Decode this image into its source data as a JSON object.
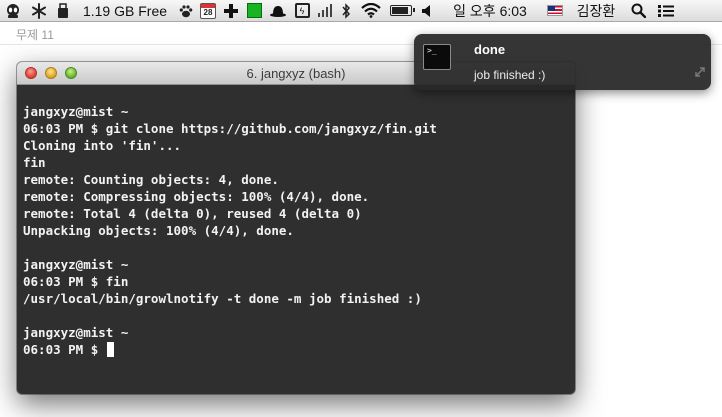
{
  "menubar": {
    "icons": [
      "alien-icon",
      "paw-print-icon",
      "asterisk-icon"
    ],
    "memory": "1.19 GB Free",
    "calendar_day": "28",
    "datetime": "일 오후 6:03",
    "user": "김장환"
  },
  "document": {
    "title": "무제 11"
  },
  "terminal": {
    "title": "6. jangxyz (bash)",
    "lines": [
      "jangxyz@mist ~",
      "06:03 PM $ git clone https://github.com/jangxyz/fin.git",
      "Cloning into 'fin'...",
      "fin",
      "remote: Counting objects: 4, done.",
      "remote: Compressing objects: 100% (4/4), done.",
      "remote: Total 4 (delta 0), reused 4 (delta 0)",
      "Unpacking objects: 100% (4/4), done.",
      "",
      "jangxyz@mist ~",
      "06:03 PM $ fin",
      "/usr/local/bin/growlnotify -t done -m job finished :)",
      "",
      "jangxyz@mist ~",
      "06:03 PM $ "
    ]
  },
  "notification": {
    "title": "done",
    "message": "job finished :)",
    "icon_text": ">_"
  },
  "colors": {
    "terminal_bg": "#2f2f2f",
    "terminal_text": "#f2f2f2",
    "growl_bg": "#282828"
  }
}
